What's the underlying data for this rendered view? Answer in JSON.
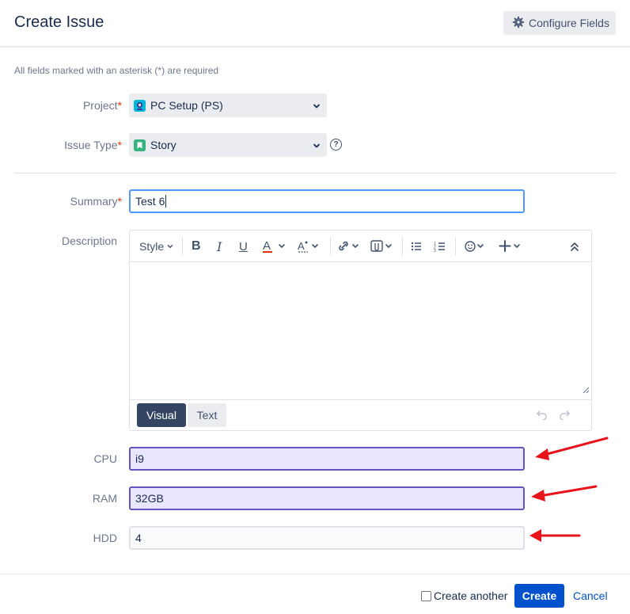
{
  "dialog": {
    "title": "Create Issue",
    "configure_fields_label": "Configure Fields",
    "required_note": "All fields marked with an asterisk (*) are required"
  },
  "fields": {
    "project": {
      "label": "Project",
      "value": "PC Setup (PS)",
      "icon": "project-avatar-icon"
    },
    "issue_type": {
      "label": "Issue Type",
      "value": "Story",
      "icon": "story-icon"
    },
    "summary": {
      "label": "Summary",
      "value": "Test 6"
    },
    "description": {
      "label": "Description"
    },
    "cpu": {
      "label": "CPU",
      "value": "i9"
    },
    "ram": {
      "label": "RAM",
      "value": "32GB"
    },
    "hdd": {
      "label": "HDD",
      "value": "4"
    }
  },
  "editor": {
    "style_label": "Style",
    "tab_visual": "Visual",
    "tab_text": "Text"
  },
  "footer": {
    "create_another_label": "Create another",
    "create_label": "Create",
    "cancel_label": "Cancel"
  },
  "colors": {
    "primary": "#0052cc",
    "required_star": "#de350b",
    "highlight_border": "#6554c0",
    "highlight_fill": "#eae6ff",
    "annotation_arrow": "#e8141b"
  }
}
